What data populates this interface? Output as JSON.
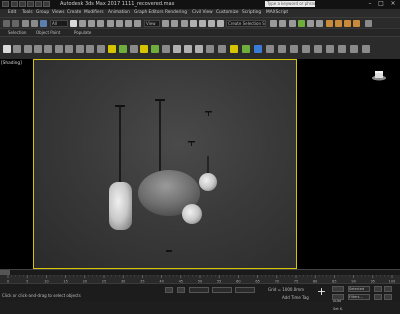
{
  "window": {
    "title": "Autodesk 3ds Max 2017     1111_recovered.max",
    "search_placeholder": "Type a keyword or phrase"
  },
  "menu": {
    "items": [
      "Edit",
      "Tools",
      "Group",
      "Views",
      "Create",
      "Modifiers",
      "Animation",
      "Graph Editors",
      "Rendering",
      "Civil View",
      "Customize",
      "Scripting",
      "MAXScript"
    ]
  },
  "toolbar": {
    "filter_dropdown": "All",
    "view_dropdown": "View",
    "selection_set_dropdown": "Create Selection Se"
  },
  "ribbon": {
    "tabs": [
      "Selection",
      "Object Paint",
      "Populate"
    ]
  },
  "viewport": {
    "label": "[Shading]"
  },
  "status": {
    "line1": "",
    "line2": "Click or click-and-drag to select objects",
    "grid": "Grid = 1000.0mm",
    "add_time_tag": "Add Time Tag",
    "auto": "Auto",
    "set_key": "Set K.",
    "filter": "Selected",
    "filters_btn": "Filters..."
  },
  "timeline": {
    "ticks": [
      "0",
      "5",
      "10",
      "15",
      "20",
      "25",
      "30",
      "35",
      "40",
      "45",
      "50",
      "55",
      "60",
      "65",
      "70",
      "75",
      "80",
      "85",
      "90",
      "95",
      "100"
    ]
  },
  "colors": {
    "viewport_border": "#d6c400",
    "accent_green": "#6fae3c",
    "accent_blue": "#3a7bd5"
  }
}
